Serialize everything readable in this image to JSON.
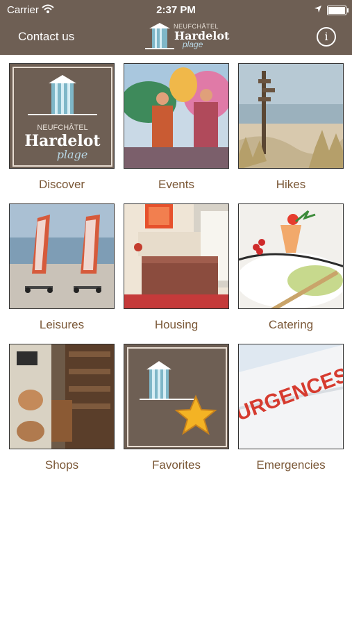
{
  "status": {
    "carrier": "Carrier",
    "time": "2:37 PM"
  },
  "nav": {
    "contact_label": "Contact us",
    "logo_top": "NEUFCHÂTEL",
    "logo_main": "Hardelot",
    "logo_sub": "plage",
    "info_icon": "i"
  },
  "tiles": [
    {
      "label": "Discover",
      "name": "discover"
    },
    {
      "label": "Events",
      "name": "events"
    },
    {
      "label": "Hikes",
      "name": "hikes"
    },
    {
      "label": "Leisures",
      "name": "leisures"
    },
    {
      "label": "Housing",
      "name": "housing"
    },
    {
      "label": "Catering",
      "name": "catering"
    },
    {
      "label": "Shops",
      "name": "shops"
    },
    {
      "label": "Favorites",
      "name": "favorites"
    },
    {
      "label": "Emergencies",
      "name": "emergencies"
    }
  ],
  "tile_text": {
    "discover_top": "NEUFCHÂTEL",
    "discover_main": "Hardelot",
    "discover_sub": "plage",
    "emergencies_sign": "URGENCES"
  },
  "colors": {
    "brand_brown": "#6e5f54",
    "label_brown": "#7a5736"
  }
}
